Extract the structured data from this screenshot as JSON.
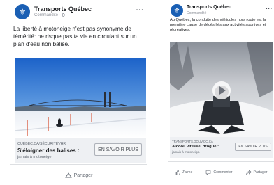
{
  "post1": {
    "page_name": "Transports Québec",
    "sponsored": "Commandité",
    "globe_icon": "globe-icon",
    "more": "...",
    "caption": "La liberté à motoneige n'est pas synonyme de témérité: ne risque pas ta vie en circulant sur un plan d'eau non balisé.",
    "link_url": "QUÉBEC.CA/SÉCURITÉVHR",
    "link_title": "S'éloigner des balises :",
    "link_desc": "jamais à motoneige!",
    "cta": "EN SAVOIR PLUS",
    "share": "Partager"
  },
  "post2": {
    "page_name": "Transports Québec",
    "sponsored": "Commandité",
    "more": "...",
    "caption": "Au Québec, la conduite des véhicules hors route est la première cause de décès liés aux activités sportives et récréatives.",
    "link_url": "TRANSPORTS.GOUV.QC.CA",
    "link_title": "Alcool, vitesse, drogue :",
    "link_desc": "jamais à motoneige.",
    "cta": "EN SAVOIR PLUS",
    "like": "J'aime",
    "comment": "Commenter",
    "share": "Partager"
  },
  "colors": {
    "brand": "#1a5fb4",
    "text": "#1c1e21",
    "muted": "#606770"
  }
}
